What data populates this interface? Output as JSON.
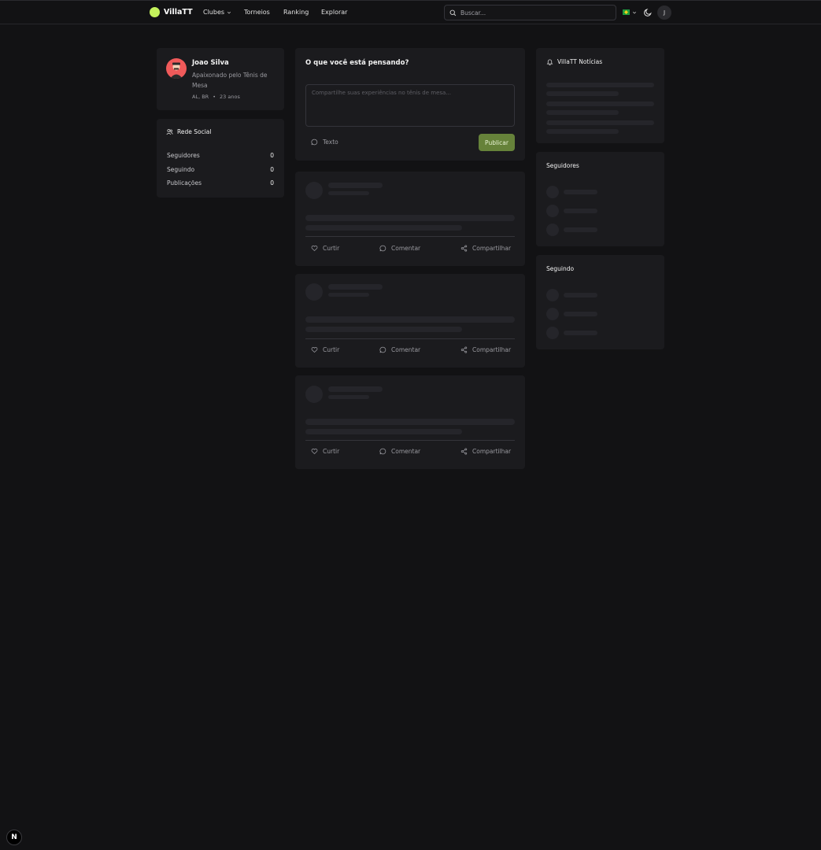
{
  "app": {
    "logo_text": "VillaTT",
    "brand_color": "#c4f25c"
  },
  "nav": {
    "items": [
      {
        "label": "Clubes",
        "has_dropdown": true
      },
      {
        "label": "Torneios"
      },
      {
        "label": "Ranking"
      },
      {
        "label": "Explorar"
      }
    ]
  },
  "search": {
    "placeholder": "Buscar..."
  },
  "header": {
    "language": "BR",
    "user_initial": "J"
  },
  "profile": {
    "name": "Joao Silva",
    "bio": "Apaixonado pelo Tênis de Mesa",
    "location": "AL, BR",
    "separator": "•",
    "age": "23 anos"
  },
  "social": {
    "title": "Rede Social",
    "rows": [
      {
        "label": "Seguidores",
        "value": "0"
      },
      {
        "label": "Seguindo",
        "value": "0"
      },
      {
        "label": "Publicações",
        "value": "0"
      }
    ]
  },
  "composer": {
    "title": "O que você está pensando?",
    "placeholder": "Compartilhe suas experiências no tênis de mesa...",
    "type_label": "Texto",
    "publish_label": "Publicar",
    "accent_color": "#66823a"
  },
  "post_actions": {
    "like": "Curtir",
    "comment": "Comentar",
    "share": "Compartilhar"
  },
  "right": {
    "news_title": "VillaTT Notícias",
    "followers_title": "Seguidores",
    "following_title": "Seguindo"
  },
  "dev": {
    "badge": "N"
  }
}
